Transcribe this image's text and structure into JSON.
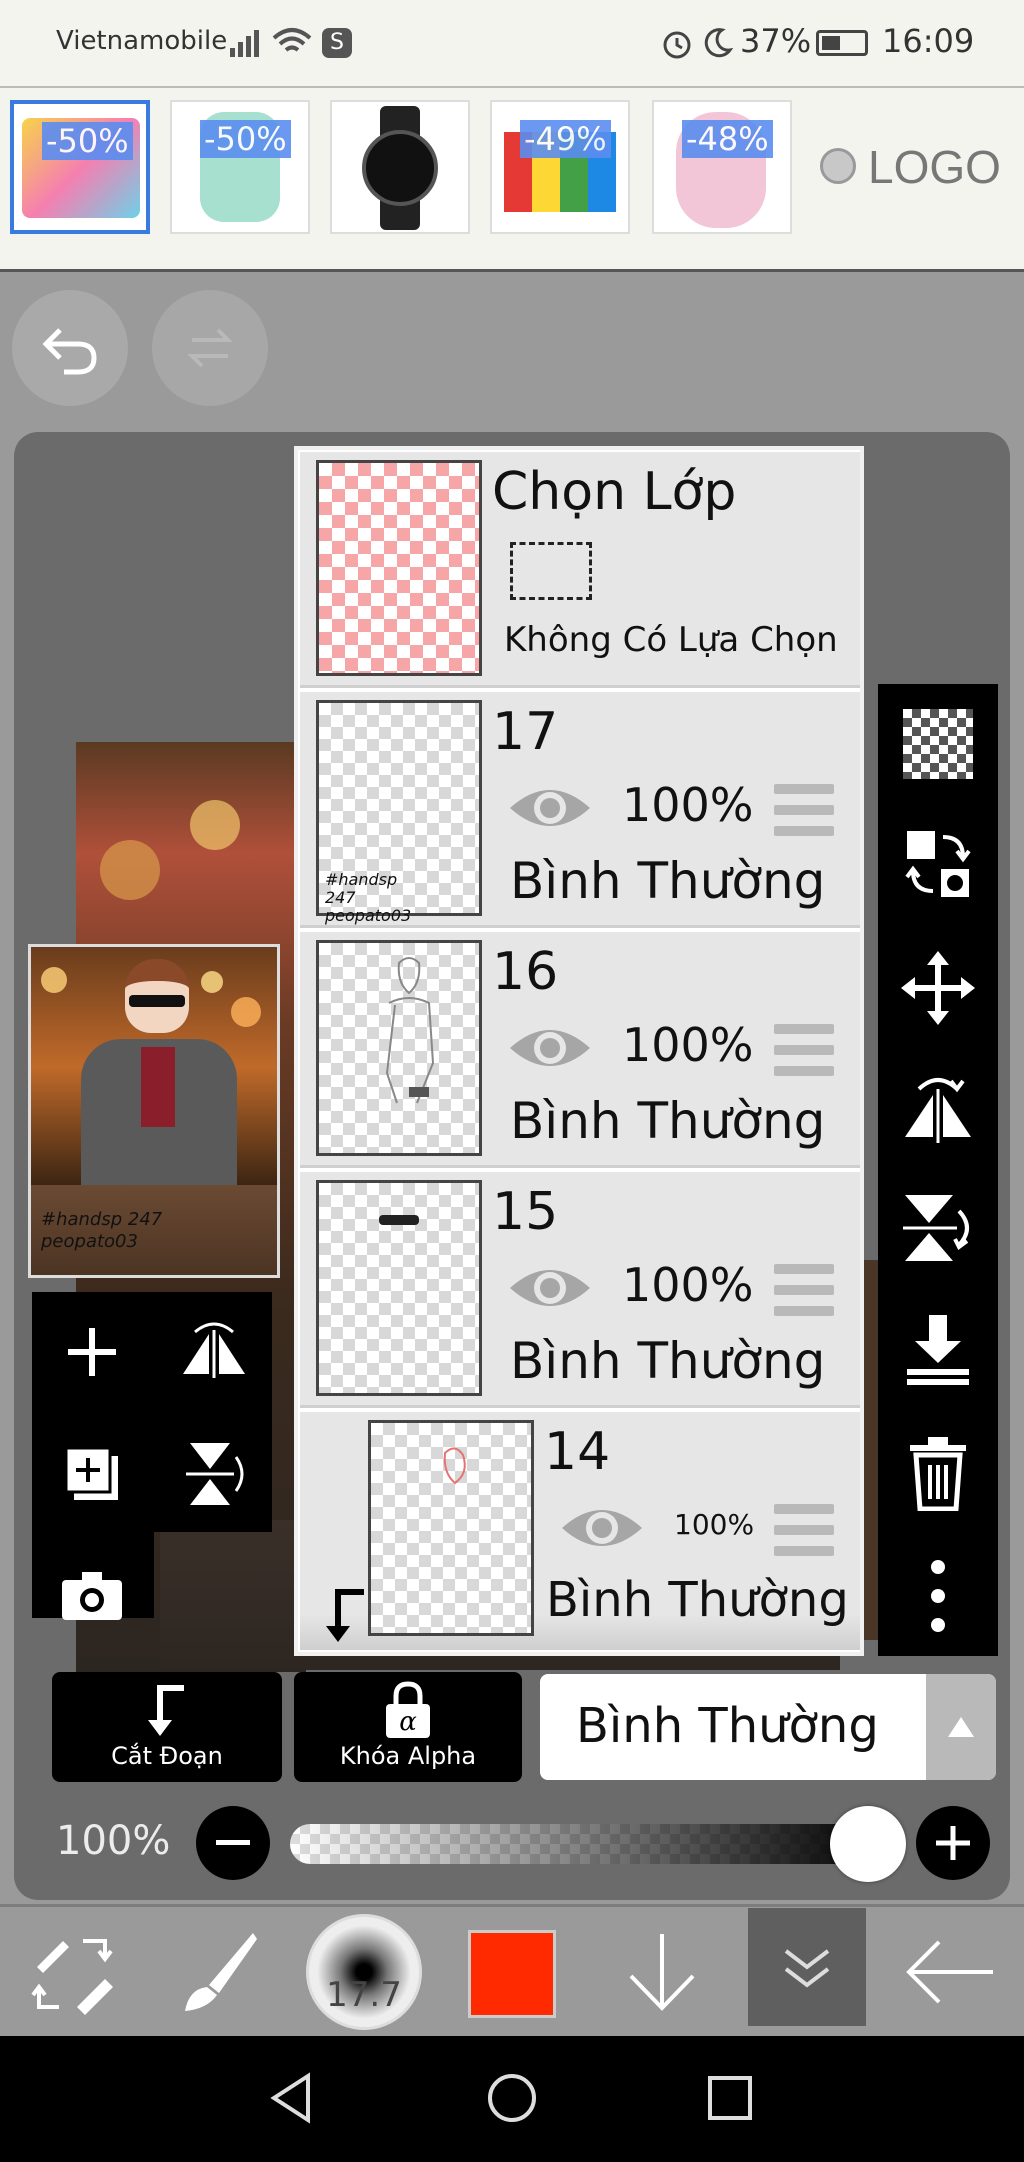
{
  "status_bar": {
    "carrier": "Vietnamobile",
    "battery": "37%",
    "time": "16:09"
  },
  "ad": {
    "discounts": [
      "-50%",
      "-50%",
      "-49%",
      "-48%"
    ],
    "logo_text": "LOGO"
  },
  "layers_panel": {
    "selection": {
      "title": "Chọn Lớp",
      "subtitle": "Không Có Lựa Chọn"
    },
    "layers": [
      {
        "number": "17",
        "opacity": "100%",
        "mode": "Bình Thường"
      },
      {
        "number": "16",
        "opacity": "100%",
        "mode": "Bình Thường"
      },
      {
        "number": "15",
        "opacity": "100%",
        "mode": "Bình Thường"
      },
      {
        "number": "14",
        "opacity": "100%",
        "mode": "Bình Thường"
      }
    ]
  },
  "canvas_preview": {
    "signature": "#handsp 247 peopato03"
  },
  "bottom_controls": {
    "clip_label": "Cắt Đoạn",
    "alpha_lock_label": "Khóa Alpha",
    "blend_mode": "Bình Thường",
    "opacity_label": "100%"
  },
  "toolbar": {
    "brush_size": "17.7",
    "color": "#ff2a00"
  },
  "colors": {
    "accent_badge": "#5b8df0",
    "panel_bg": "#e6e6e6",
    "toolbar_bg": "#000000"
  }
}
